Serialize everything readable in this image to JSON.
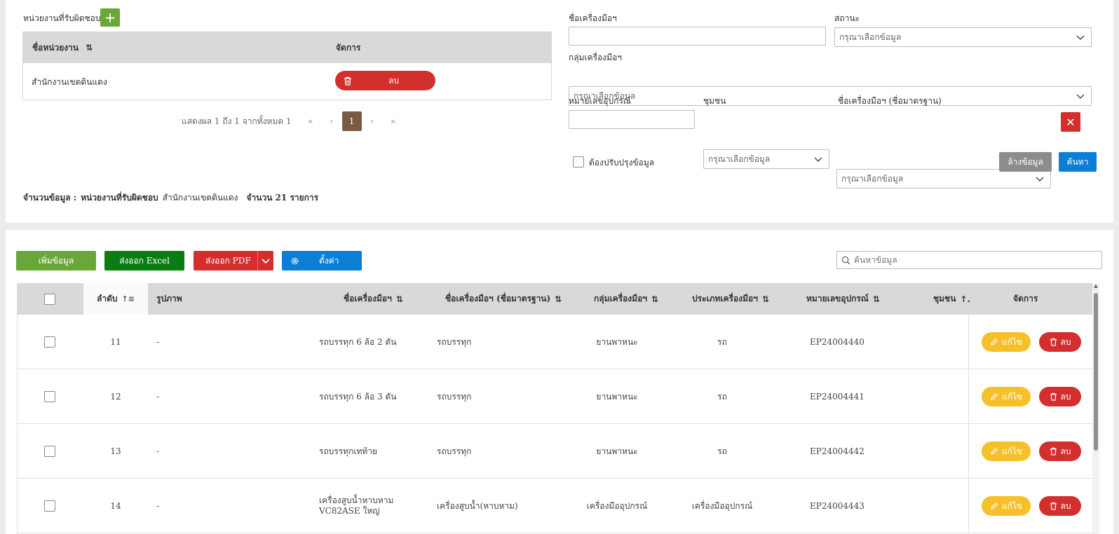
{
  "units": {
    "title": "หน่วยงานที่รับผิดชอบ",
    "add_icon": "plus-icon",
    "col_name": "ชื่อหน่วยงาน",
    "col_manage": "จัดการ",
    "rows": [
      {
        "name": "สำนักงานเขตดินแดง",
        "delete_label": "ลบ"
      }
    ],
    "pager": {
      "summary": "แสดงผล 1 ถึง 1 จากทั้งหมด 1",
      "first": "«",
      "prev": "‹",
      "current": "1",
      "next": "›",
      "last": "»"
    }
  },
  "filters": {
    "tool_name_label": "ชื่อเครื่องมือฯ",
    "tool_name_value": "",
    "status_label": "สถานะ",
    "status_value": "กรุณาเลือกข้อมูล",
    "group_label": "กลุ่มเครื่องมือฯ",
    "group_value": "กรุณาเลือกข้อมูล",
    "equipment_no_label": "หมายเลขอุปกรณ์",
    "equipment_no_value": "",
    "community_label": "ชุมชน",
    "community_value": "กรุณาเลือกข้อมูล",
    "std_name_label": "ชื่อเครื่องมือฯ (ชื่อมาตรฐาน)",
    "std_name_value": "กรุณาเลือกข้อมูล",
    "needs_update_label": "ต้องปรับปรุงข้อมูล",
    "needs_update_checked": false,
    "clear_label": "ล้างข้อมูล",
    "search_label": "ค้นหา"
  },
  "summary": {
    "prefix": "จำนวนข้อมูล :",
    "unit_label": "หน่วยงานที่รับผิดชอบ",
    "unit_value": "สำนักงานเขตดินแดง",
    "count_text": "จำนวน 21 รายการ"
  },
  "toolbar": {
    "add_label": "เพิ่มข้อมูล",
    "excel_label": "ส่งออก Excel",
    "pdf_label": "ส่งออก PDF",
    "settings_label": "ตั้งค่า",
    "search_placeholder": "ค้นหาข้อมูล"
  },
  "table": {
    "headers": {
      "seq": "ลำดับ",
      "image": "รูปภาพ",
      "name": "ชื่อเครื่องมือฯ",
      "std_name": "ชื่อเครื่องมือฯ (ชื่อมาตรฐาน)",
      "group": "กลุ่มเครื่องมือฯ",
      "type": "ประเภทเครื่องมือฯ",
      "equip_no": "หมายเลขอุปกรณ์",
      "community": "ชุมชน",
      "manage": "จัดการ"
    },
    "edit_label": "แก้ไข",
    "delete_label": "ลบ",
    "rows": [
      {
        "seq": "11",
        "image": "-",
        "name": "รถบรรทุก 6 ล้อ 2 ตัน",
        "std_name": "รถบรรทุก",
        "group": "ยานพาหนะ",
        "type": "รถ",
        "equip_no": "EP24004440",
        "community": ""
      },
      {
        "seq": "12",
        "image": "-",
        "name": "รถบรรทุก 6 ล้อ 3 ตัน",
        "std_name": "รถบรรทุก",
        "group": "ยานพาหนะ",
        "type": "รถ",
        "equip_no": "EP24004441",
        "community": ""
      },
      {
        "seq": "13",
        "image": "-",
        "name": "รถบรรทุกเทท้าย",
        "std_name": "รถบรรทุก",
        "group": "ยานพาหนะ",
        "type": "รถ",
        "equip_no": "EP24004442",
        "community": ""
      },
      {
        "seq": "14",
        "image": "-",
        "name": "เครื่องสูบน้ำหาบหาม VC82ASE ใหญ่",
        "std_name": "เครื่องสูบน้ำ(หาบหาม)",
        "group": "เครื่องมืออุปกรณ์",
        "type": "เครื่องมืออุปกรณ์",
        "equip_no": "EP24004443",
        "community": ""
      }
    ]
  },
  "colors": {
    "green": "#6aa739",
    "dark_green": "#0a7d12",
    "red": "#d32f2f",
    "blue": "#0b7fd6",
    "yellow": "#f6c02b",
    "brown": "#7a5a44"
  }
}
